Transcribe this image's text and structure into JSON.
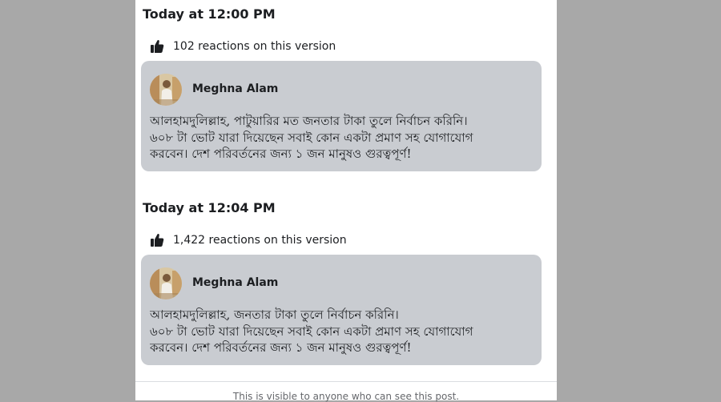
{
  "versions": [
    {
      "time": "Today at 12:00 PM",
      "reactions": "102 reactions on this version",
      "author": "Meghna Alam",
      "lines": [
        "আলহামদুলিল্লাহ, পাটুয়ারির মত জনতার টাকা তুলে নির্বাচন করিনি।",
        "৬০৮ টা ভোট যারা দিয়েছেন সবাই কোন একটা প্রমাণ সহ যোগাযোগ",
        "করবেন। দেশ পরিবর্তনের জন্য ১ জন মানুষও গুরত্বপূর্ণ!"
      ]
    },
    {
      "time": "Today at 12:04 PM",
      "reactions": "1,422 reactions on this version",
      "author": "Meghna Alam",
      "lines": [
        "আলহামদুলিল্লাহ,  জনতার টাকা তুলে নির্বাচন করিনি।",
        "৬০৮ টা ভোট যারা দিয়েছেন সবাই কোন একটা প্রমাণ সহ যোগাযোগ",
        "করবেন। দেশ পরিবর্তনের জন্য ১ জন মানুষও গুরত্বপূর্ণ!"
      ]
    }
  ],
  "footer": {
    "visibility_note": "This is visible to anyone who can see this post."
  },
  "icons": {
    "reaction": "thumbs-up-icon",
    "avatar": "profile-photo"
  },
  "colors": {
    "backdrop": "#a8a8a8",
    "panel": "#ffffff",
    "card": "#c9ccd1",
    "text": "#1c1e21",
    "muted": "#65676b"
  }
}
